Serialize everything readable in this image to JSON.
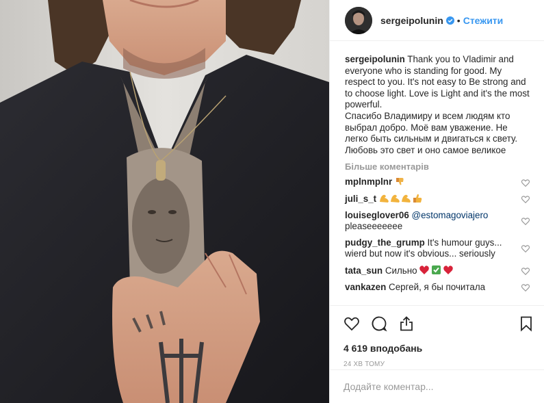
{
  "post": {
    "username": "sergeipolunin",
    "follow_label": "Стежити",
    "separator": "•",
    "caption": {
      "username": "sergeipolunin",
      "text": "Thank you to Vladimir and everyone who is standing for good. My respect to you. It's not easy to Be strong and to choose light. Love is Light and it's the most powerful.",
      "text_ru": "Спасибо Владимиру и всем людям кто выбрал добро. Моё вам уважение. Не легко быть сильным и двигаться к свету. Любовь это свет и оно самое великое"
    },
    "more_comments_label": "Більше коментарів",
    "comments": [
      {
        "user": "mplnmplnr",
        "text": "",
        "emoji": "thumbs-down-icon"
      },
      {
        "user": "juli_s_t",
        "text": "",
        "emoji": "flexed-biceps-icons"
      },
      {
        "user": "louiseglover06",
        "mention": "@estomagoviajero",
        "text": "pleaseeeeeee"
      },
      {
        "user": "pudgy_the_grump",
        "text": "It's humour guys... wierd but now it's obvious... seriously"
      },
      {
        "user": "tata_sun",
        "text": "Сильно",
        "emoji": "hearts-check-icons"
      },
      {
        "user": "vankazen",
        "text": "Сергей, я бы почитала"
      }
    ],
    "likes": "4 619 вподобань",
    "timestamp": "24 ХВ ТОМУ",
    "add_comment_placeholder": "Додайте коментар..."
  },
  "colors": {
    "link_blue": "#3897f0",
    "mention_blue": "#003569",
    "muted": "#999999",
    "text": "#262626",
    "border": "#efefef"
  },
  "icons": [
    "verified-badge-icon",
    "heart-icon",
    "comment-icon",
    "share-icon",
    "bookmark-icon"
  ]
}
